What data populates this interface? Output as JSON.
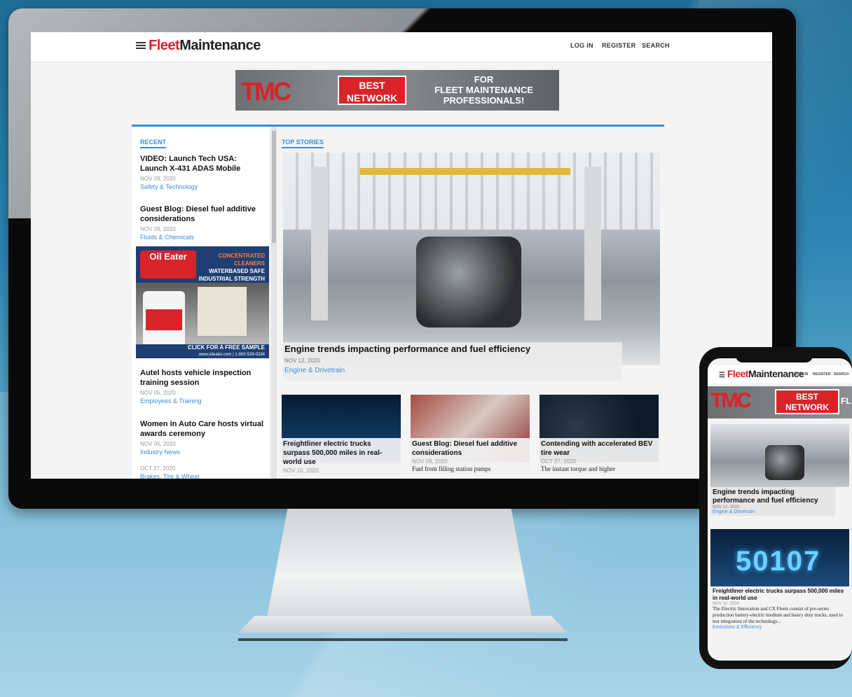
{
  "site": {
    "logo_part1": "Fleet",
    "logo_part2": "Maintenance",
    "nav": [
      "LOG IN",
      "REGISTER",
      "SEARCH"
    ]
  },
  "banner": {
    "logo_text": "TMC",
    "best_line1": "BEST",
    "best_line2": "NETWORK",
    "right_line1": "FOR",
    "right_line2": "FLEET MAINTENANCE",
    "right_line3": "PROFESSIONALS!"
  },
  "recent": {
    "label": "RECENT",
    "items": [
      {
        "title": "VIDEO: Launch Tech USA: Launch X-431 ADAS Mobile",
        "date": "NOV 09, 2020",
        "category": "Safety & Technology"
      },
      {
        "title": "Guest Blog: Diesel fuel additive considerations",
        "date": "NOV 09, 2020",
        "category": "Fluids & Chemicals"
      },
      {
        "title": "Autel hosts vehicle inspection training session",
        "date": "NOV 05, 2020",
        "category": "Employees & Training"
      },
      {
        "title": "Women in Auto Care hosts virtual awards ceremony",
        "date": "NOV 05, 2020",
        "category": "Industry News"
      },
      {
        "title": "",
        "date": "OCT 27, 2020",
        "category": "Brakes, Tire & Wheel"
      }
    ]
  },
  "ad": {
    "brand": "Oil Eater",
    "line1": "CONCENTRATED CLEANERS",
    "line2": "WATERBASED SAFE",
    "line3": "INDUSTRIAL STRENGTH",
    "cta": "CLICK FOR A FREE SAMPLE",
    "contact": "www.oileater.com | 1-800-528-0334"
  },
  "top_stories": {
    "label": "TOP STORIES",
    "main": {
      "title": "Engine trends impacting performance and fuel efficiency",
      "date": "NOV 12, 2020",
      "category": "Engine & Drivetrain"
    },
    "cards": [
      {
        "title": "Freightliner electric trucks surpass 500,000 miles in real-world use",
        "date": "NOV 10, 2020",
        "desc": ""
      },
      {
        "title": "Guest Blog: Diesel fuel additive considerations",
        "date": "NOV 09, 2020",
        "desc": "Fuel from filling station pumps"
      },
      {
        "title": "Contending with accelerated BEV tire wear",
        "date": "OCT 27, 2020",
        "desc": "The instant torque and higher"
      }
    ]
  },
  "phone": {
    "nav": [
      "LOG IN",
      "REGISTER",
      "SEARCH"
    ],
    "banner_fl": "FL",
    "main_title": "Engine trends impacting performance and fuel efficiency",
    "main_date": "NOV 12, 2020",
    "main_category": "Engine & Drivetrain",
    "card_big_text": "50107",
    "card_title": "Freightliner electric trucks surpass 500,000 miles in real-world use",
    "card_date": "NOV 10, 2020",
    "card_desc": "The Electric Innovation and CX Fleets consist of pre-series production battery-electric medium and heavy duty trucks, used to test integration of the technology...",
    "card_category": "Emissions & Efficiency"
  },
  "colors": {
    "brand_red": "#d8232a",
    "accent_blue": "#3a8fd6"
  }
}
